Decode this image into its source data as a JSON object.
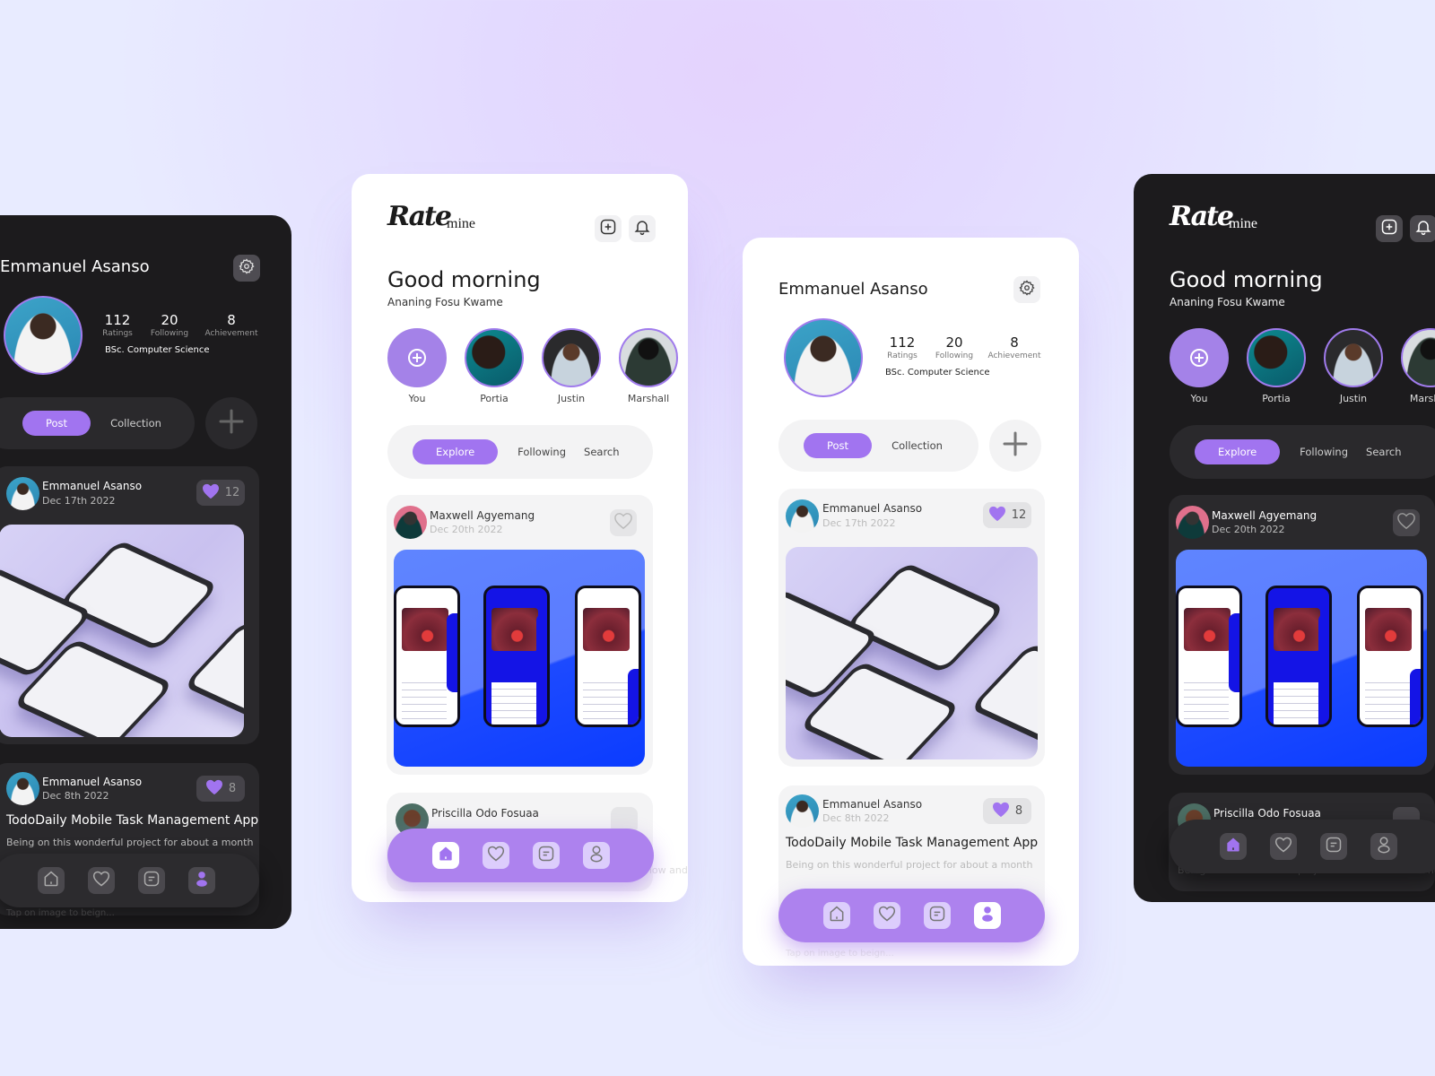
{
  "brand": {
    "logo_script": "Rate",
    "logo_sub": "mine"
  },
  "colors": {
    "accent": "#a174f0",
    "accent_nav": "#ad82ee",
    "dark_bg": "#1c1b1d",
    "light_bg": "#ffffff",
    "page_bg": "#e6e3ff"
  },
  "home": {
    "greeting": "Good morning",
    "username": "Ananing Fosu Kwame",
    "header_icons": [
      "add-square-icon",
      "bell-icon"
    ],
    "stories": [
      {
        "label": "You",
        "is_add": true
      },
      {
        "label": "Portia"
      },
      {
        "label": "Justin"
      },
      {
        "label": "Marshall"
      }
    ],
    "tabs": [
      "Explore",
      "Following",
      "Search"
    ],
    "active_tab": "Explore",
    "posts": [
      {
        "author": "Maxwell Agyemang",
        "date": "Dec 20th 2022",
        "liked": false
      },
      {
        "author": "Priscilla Odo Fosuaa",
        "desc": "Being on this wonderful project for about a month now and I really happy today to showcase this one"
      }
    ],
    "nav": [
      "home-icon",
      "heart-icon",
      "document-icon",
      "profile-icon"
    ],
    "active_nav": "home"
  },
  "profile": {
    "name": "Emmanuel Asanso",
    "stats": [
      {
        "value": "112",
        "label": "Ratings"
      },
      {
        "value": "20",
        "label": "Following"
      },
      {
        "value": "8",
        "label": "Achievement"
      }
    ],
    "degree": "BSc. Computer Science",
    "tabs": [
      "Post",
      "Collection"
    ],
    "active_tab": "Post",
    "posts": [
      {
        "author": "Emmanuel Asanso",
        "date": "Dec 17th 2022",
        "likes": "12"
      },
      {
        "author": "Emmanuel Asanso",
        "date": "Dec 8th 2022",
        "likes": "8",
        "title": "TodoDaily Mobile Task Management App",
        "desc": "Being on this wonderful project for about a month"
      }
    ],
    "hint": "Tap on image to beign...",
    "nav": [
      "home-icon",
      "heart-icon",
      "document-icon",
      "profile-icon"
    ],
    "active_nav": "profile"
  }
}
